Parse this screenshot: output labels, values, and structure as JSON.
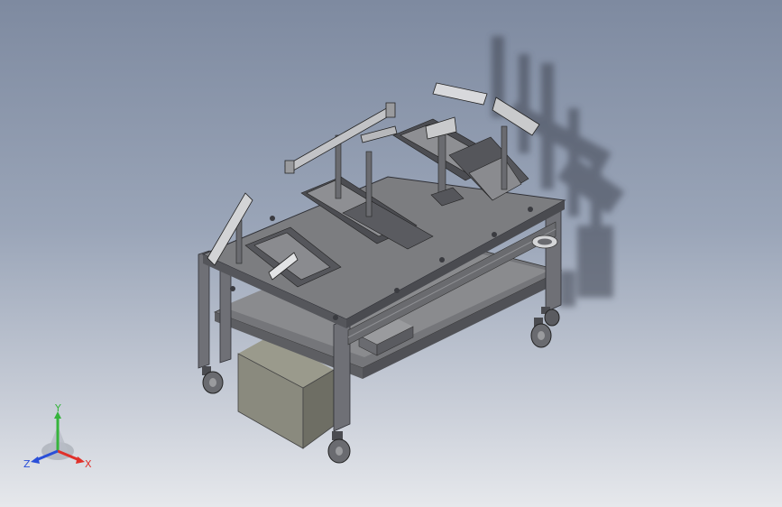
{
  "viewport": {
    "background_top": "#7e8aa0",
    "background_bottom": "#e6e8ec"
  },
  "triad": {
    "x_label": "X",
    "y_label": "Y",
    "z_label": "Z",
    "x_color": "#e0302a",
    "y_color": "#36b43c",
    "z_color": "#2a4fd8"
  },
  "model": {
    "frame_color": "#6f7076",
    "plate_color": "#7c7d80",
    "box_color": "#8a8a7e",
    "shadow_color": "#3d4250",
    "highlight_color": "#c9cacc"
  }
}
